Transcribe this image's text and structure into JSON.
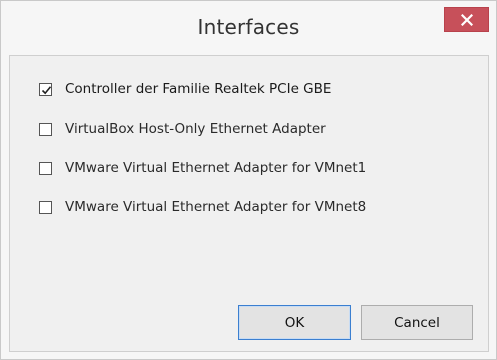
{
  "window": {
    "title": "Interfaces"
  },
  "interfaces": [
    {
      "label": "Controller der Familie Realtek PCIe GBE",
      "checked": true
    },
    {
      "label": "VirtualBox Host-Only Ethernet Adapter",
      "checked": false
    },
    {
      "label": "VMware Virtual Ethernet Adapter for VMnet1",
      "checked": false
    },
    {
      "label": "VMware Virtual Ethernet Adapter for VMnet8",
      "checked": false
    }
  ],
  "buttons": {
    "ok_label": "OK",
    "cancel_label": "Cancel"
  },
  "icons": {
    "close": "close-icon",
    "check": "checkmark-icon"
  },
  "colors": {
    "close_button": "#c7505a",
    "default_button_border": "#3b7fd0"
  }
}
